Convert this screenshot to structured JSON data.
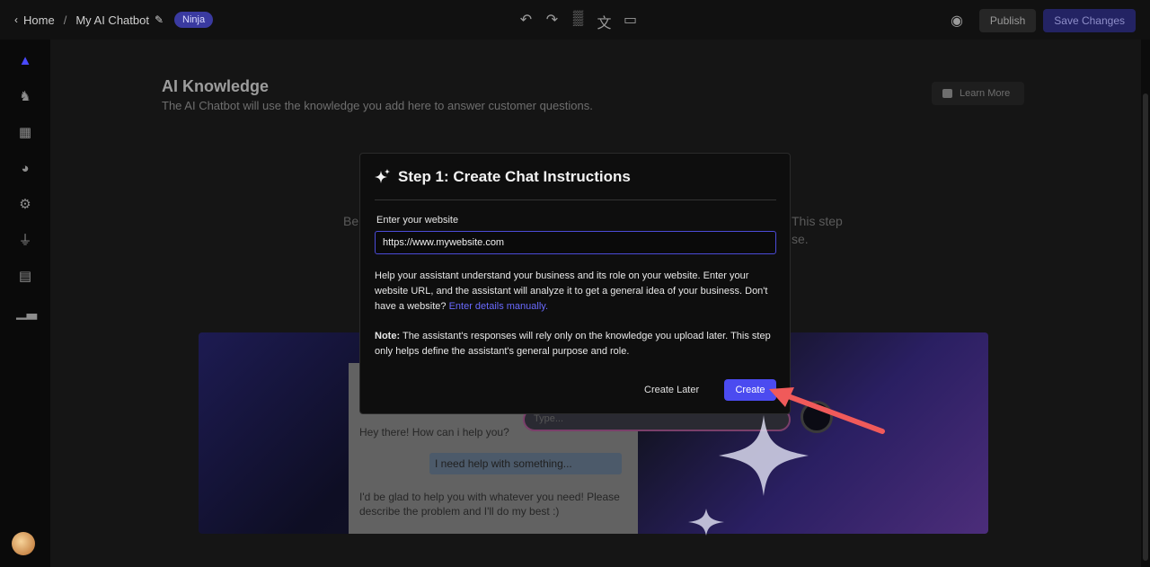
{
  "topbar": {
    "home_label": "Home",
    "separator": "/",
    "page_name": "My AI Chatbot",
    "badge": "Ninja",
    "publish_label": "Publish",
    "save_label": "Save Changes",
    "icons": [
      "undo-icon",
      "redo-icon",
      "paint-roller-icon",
      "translate-icon",
      "monitor-icon"
    ]
  },
  "sidebar": {
    "items": [
      "graduation-cap-icon",
      "chess-knight-icon",
      "table-icon",
      "palette-icon",
      "gear-icon",
      "plug-icon",
      "calendar-icon",
      "bar-chart-icon"
    ]
  },
  "main": {
    "title": "AI Knowledge",
    "subtitle": "The AI Chatbot will use the knowledge you add here to answer customer questions.",
    "learn_more": "Learn More",
    "bg_fragment_left": "Be",
    "bg_fragment_right_1": "This step",
    "bg_fragment_right_2": "se."
  },
  "preview": {
    "bot_greeting": "Hey there! How can i help you?",
    "user_message": "I need help with something...",
    "bot_reply": "I'd be glad to help you with whatever you need! Please describe the problem and I'll do my best :)",
    "input_placeholder": "Type..."
  },
  "modal": {
    "title": "Step 1: Create Chat Instructions",
    "field_label": "Enter your website",
    "url_value": "https://www.mywebsite.com",
    "help_text": "Help your assistant understand your business and its role on your website. Enter your website URL, and the assistant will analyze it to get a general idea of your business. Don't have a website?",
    "help_link": "Enter details manually.",
    "note_label": "Note:",
    "note_text": "The assistant's responses will rely only on the knowledge you upload later. This step only helps define the assistant's general purpose and role.",
    "later_label": "Create Later",
    "create_label": "Create"
  },
  "colors": {
    "accent": "#4b4bf0",
    "link": "#6a6aff",
    "annotation_arrow": "#f05a5a"
  }
}
